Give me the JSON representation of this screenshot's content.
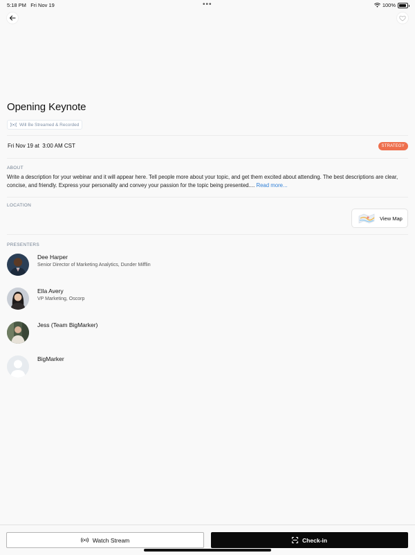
{
  "status_bar": {
    "time": "5:18 PM",
    "date": "Fri Nov 19",
    "battery": "100%"
  },
  "event": {
    "title": "Opening Keynote",
    "stream_tag": "Will Be Streamed & Recorded",
    "date": "Fri Nov 19 at",
    "time": "3:00 AM CST",
    "badge": "STRATEGY"
  },
  "about": {
    "label": "ABOUT",
    "text": " Write a description for your webinar and it will appear here. Tell people more about your topic, and get them excited about attending. The best descriptions are clear, concise, and friendly. Express your personality and convey your passion for the topic being presented....",
    "read_more": "Read more..."
  },
  "location": {
    "label": "LOCATION",
    "view_map": "View Map"
  },
  "presenters": {
    "label": "PRESENTERS",
    "items": [
      {
        "name": "Dee Harper",
        "role": "Senior Director of Marketing Analytics, Dunder Mifflin"
      },
      {
        "name": "Ella Avery",
        "role": "VP Marketing, Oscorp"
      },
      {
        "name": "Jess (Team BigMarker)",
        "role": ""
      },
      {
        "name": "BigMarker",
        "role": ""
      }
    ]
  },
  "actions": {
    "watch": "Watch Stream",
    "checkin": "Check-in"
  },
  "colors": {
    "badge": "#ee6f4d",
    "link": "#2f7fd6",
    "primary_button": "#0a0a0a"
  },
  "icons": [
    "back-arrow-icon",
    "heart-icon",
    "wifi-icon",
    "battery-icon",
    "broadcast-icon",
    "map-icon",
    "qr-scan-icon"
  ]
}
